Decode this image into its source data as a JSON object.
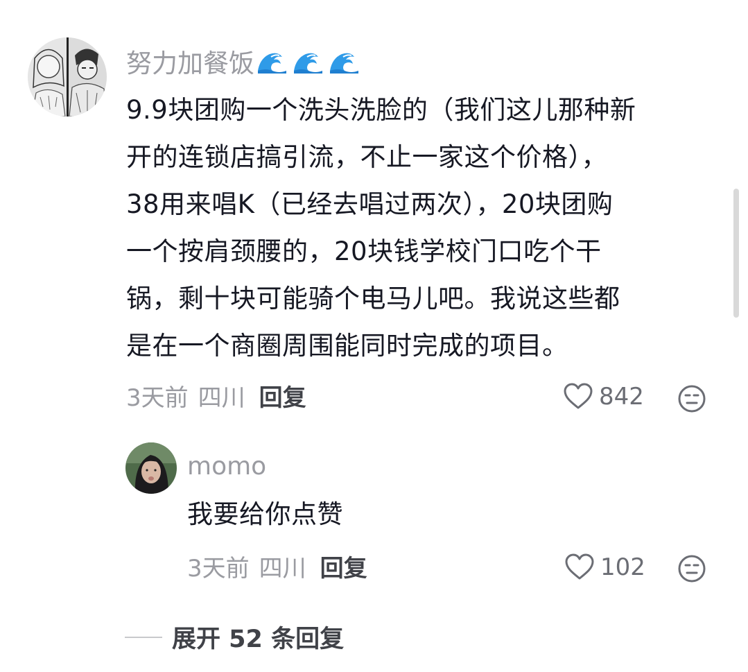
{
  "comments": [
    {
      "username": "努力加餐饭",
      "username_emoji": [
        "wave-emoji",
        "wave-emoji",
        "wave-emoji"
      ],
      "lines": [
        "9.9块团购一个洗头洗脸的（我们这儿那种新",
        "开的连锁店搞引流，不止一家这个价格），",
        "38用来唱K（已经去唱过两次），20块团购",
        "一个按肩颈腰的，20块钱学校门口吃个干",
        "锅，剩十块可能骑个电马儿吧。我说这些都",
        "是在一个商圈周围能同时完成的项目。"
      ],
      "time": "3天前",
      "location": "四川",
      "reply_label": "回复",
      "likes": "842"
    }
  ],
  "replies": [
    {
      "username": "momo",
      "text": "我要给你点赞",
      "time": "3天前",
      "location": "四川",
      "reply_label": "回复",
      "likes": "102"
    }
  ],
  "expand_label": "展开 52 条回复",
  "colors": {
    "text": "#161823",
    "secondary": "#9a9ba1",
    "reply": "#404248",
    "wave_blue": "#2f9be8"
  }
}
